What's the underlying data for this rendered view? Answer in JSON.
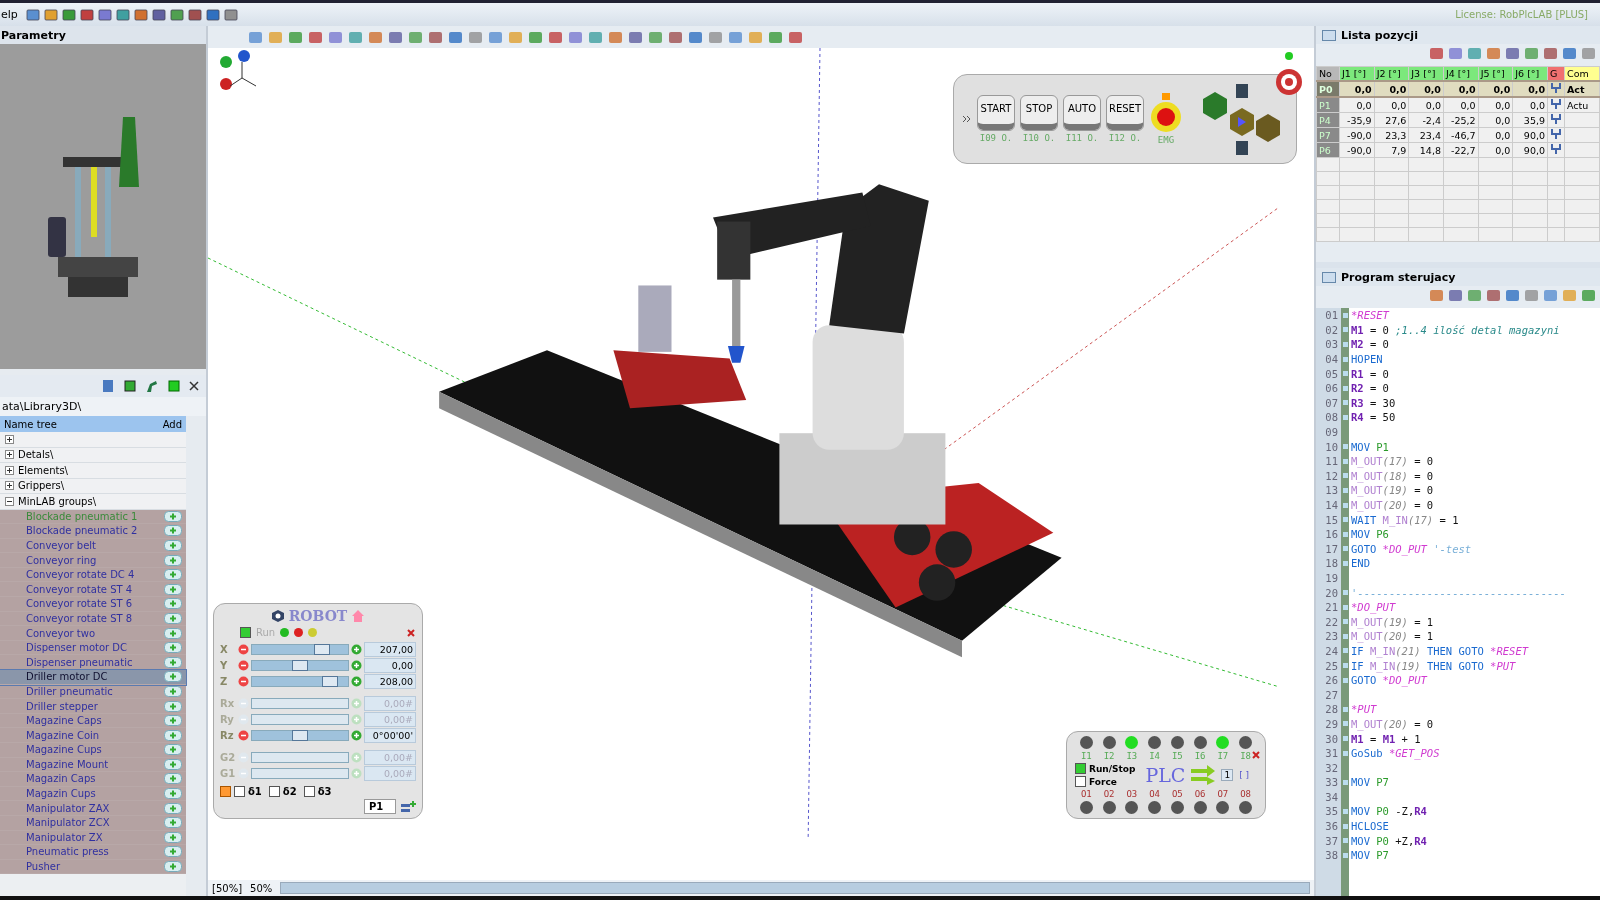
{
  "menu": {
    "label": "elp"
  },
  "license": "License: RobPlcLAB [PLUS]",
  "parameters_panel": {
    "title": "Parametry"
  },
  "library": {
    "path": "ata\\Library3D\\",
    "columns": [
      "Name tree",
      "Add"
    ],
    "tree": [
      {
        "expanded": false
      },
      {
        "label": "Detals\\",
        "expanded": false
      },
      {
        "label": "Elements\\",
        "expanded": false
      },
      {
        "label": "Grippers\\",
        "expanded": false
      },
      {
        "label": "MinLAB groups\\",
        "expanded": true,
        "children": [
          {
            "label": "Blockade pneumatic 1",
            "selected": false,
            "color": "#3a8a3a"
          },
          {
            "label": "Blockade pneumatic 2",
            "selected": false,
            "color": "#3030a0"
          },
          {
            "label": "Conveyor belt",
            "selected": false,
            "color": "#3030a0"
          },
          {
            "label": "Conveyor ring",
            "selected": false,
            "color": "#3030a0"
          },
          {
            "label": "Conveyor rotate DC 4",
            "selected": false,
            "color": "#3030a0"
          },
          {
            "label": "Conveyor rotate ST 4",
            "selected": false,
            "color": "#3030a0"
          },
          {
            "label": "Conveyor rotate ST 6",
            "selected": false,
            "color": "#3030a0"
          },
          {
            "label": "Conveyor rotate ST 8",
            "selected": false,
            "color": "#3030a0"
          },
          {
            "label": "Conveyor two",
            "selected": false,
            "color": "#3030a0"
          },
          {
            "label": "Dispenser motor DC",
            "selected": false,
            "color": "#3030a0"
          },
          {
            "label": "Dispenser pneumatic",
            "selected": false,
            "color": "#3030a0"
          },
          {
            "label": "Driller motor DC",
            "selected": true,
            "color": "#101030"
          },
          {
            "label": "Driller pneumatic",
            "selected": false,
            "color": "#3030a0"
          },
          {
            "label": "Driller stepper",
            "selected": false,
            "color": "#3030a0"
          },
          {
            "label": "Magazine Caps",
            "selected": false,
            "color": "#3030a0"
          },
          {
            "label": "Magazine Coin",
            "selected": false,
            "color": "#3030a0"
          },
          {
            "label": "Magazine Cups",
            "selected": false,
            "color": "#3030a0"
          },
          {
            "label": "Magazine Mount",
            "selected": false,
            "color": "#3030a0"
          },
          {
            "label": "Magazin Caps",
            "selected": false,
            "color": "#3030a0"
          },
          {
            "label": "Magazin Cups",
            "selected": false,
            "color": "#3030a0"
          },
          {
            "label": "Manipulator ZAX",
            "selected": false,
            "color": "#3030a0"
          },
          {
            "label": "Manipulator ZCX",
            "selected": false,
            "color": "#3030a0"
          },
          {
            "label": "Manipulator ZX",
            "selected": false,
            "color": "#3030a0"
          },
          {
            "label": "Pneumatic press",
            "selected": false,
            "color": "#3030a0"
          },
          {
            "label": "Pusher",
            "selected": false,
            "color": "#3030a0"
          }
        ]
      }
    ]
  },
  "control_panel": {
    "buttons": [
      "START",
      "STOP",
      "AUTO",
      "RESET"
    ],
    "signals": [
      "I09 O.",
      "I10 O.",
      "I11 O.",
      "I12 O."
    ],
    "emergency_label": "EMG"
  },
  "robot_panel": {
    "title": "ROBOT",
    "run_label": "Run",
    "run_checked": true,
    "axes": [
      {
        "label": "X",
        "disabled": false,
        "level": 0.78,
        "value": "207,00"
      },
      {
        "label": "Y",
        "disabled": false,
        "level": 0.5,
        "value": "0,00"
      },
      {
        "label": "Z",
        "disabled": false,
        "level": 0.87,
        "value": "208,00"
      },
      {
        "label": "Rx",
        "disabled": true,
        "value": "0,00#"
      },
      {
        "label": "Ry",
        "disabled": true,
        "value": "0,00#"
      },
      {
        "label": "Rz",
        "disabled": false,
        "level": 0.5,
        "value": "0°00'00'"
      },
      {
        "label": "G2",
        "disabled": true,
        "value": "0,00#"
      },
      {
        "label": "G1",
        "disabled": true,
        "value": "0,00#"
      }
    ],
    "options": [
      {
        "label": "δ1",
        "checked": false
      },
      {
        "label": "δ2",
        "checked": false
      },
      {
        "label": "δ3",
        "checked": false
      }
    ],
    "position": "P1"
  },
  "plc": {
    "title": "PLC",
    "inputs": [
      {
        "label": "I1",
        "on": false
      },
      {
        "label": "I2",
        "on": false
      },
      {
        "label": "I3",
        "on": true
      },
      {
        "label": "I4",
        "on": false
      },
      {
        "label": "I5",
        "on": false
      },
      {
        "label": "I6",
        "on": false
      },
      {
        "label": "I7",
        "on": true
      },
      {
        "label": "I8",
        "on": false
      }
    ],
    "outputs": [
      {
        "label": "O1",
        "on": false
      },
      {
        "label": "O2",
        "on": false
      },
      {
        "label": "O3",
        "on": false
      },
      {
        "label": "O4",
        "on": false
      },
      {
        "label": "O5",
        "on": false
      },
      {
        "label": "O6",
        "on": false
      },
      {
        "label": "O7",
        "on": false
      },
      {
        "label": "O8",
        "on": false
      }
    ],
    "options": [
      {
        "label": "Run/Stop",
        "checked": true
      },
      {
        "label": "Force",
        "checked": false
      }
    ],
    "cycle": "1",
    "brackets": "[ ]"
  },
  "status_bar": {
    "zoom_bracket": "[50%]",
    "zoom": "50%"
  },
  "position_list": {
    "title": "Lista pozycji",
    "columns": [
      "No",
      "J1 [°]",
      "J2 [°]",
      "J3 [°]",
      "J4 [°]",
      "J5 [°]",
      "J6 [°]",
      "G",
      "Com"
    ],
    "rows": [
      {
        "name": "P0",
        "values": [
          "0,0",
          "0,0",
          "0,0",
          "0,0",
          "0,0",
          "0,0"
        ],
        "comment": "Act",
        "selected": true
      },
      {
        "name": "P1",
        "values": [
          "0,0",
          "0,0",
          "0,0",
          "0,0",
          "0,0",
          "0,0"
        ],
        "comment": "Actu",
        "selected": false
      },
      {
        "name": "P4",
        "values": [
          "-35,9",
          "27,6",
          "-2,4",
          "-25,2",
          "0,0",
          "35,9"
        ],
        "selected": false
      },
      {
        "name": "P7",
        "values": [
          "-90,0",
          "23,3",
          "23,4",
          "-46,7",
          "0,0",
          "90,0"
        ],
        "selected": false
      },
      {
        "name": "P6",
        "values": [
          "-90,0",
          "7,9",
          "14,8",
          "-22,7",
          "0,0",
          "90,0"
        ],
        "selected": false
      }
    ]
  },
  "program": {
    "title": "Program sterujacy",
    "lines": [
      {
        "no": "01",
        "parts": [
          {
            "t": "*RESET",
            "kind": "label"
          }
        ]
      },
      {
        "no": "02",
        "parts": [
          {
            "t": "M1",
            "kind": "var"
          },
          {
            "t": " = 0  ",
            "kind": "op"
          },
          {
            "t": ";1..4 ilość detal magazyni",
            "kind": "comment"
          }
        ]
      },
      {
        "no": "03",
        "parts": [
          {
            "t": "M2",
            "kind": "var"
          },
          {
            "t": " = 0",
            "kind": "op"
          }
        ]
      },
      {
        "no": "04",
        "parts": [
          {
            "t": "HOPEN",
            "kind": "kw"
          }
        ]
      },
      {
        "no": "05",
        "parts": [
          {
            "t": "R1",
            "kind": "var"
          },
          {
            "t": " = 0",
            "kind": "op"
          }
        ]
      },
      {
        "no": "06",
        "parts": [
          {
            "t": "R2",
            "kind": "var"
          },
          {
            "t": " = 0",
            "kind": "op"
          }
        ]
      },
      {
        "no": "07",
        "parts": [
          {
            "t": "R3",
            "kind": "var"
          },
          {
            "t": " = 30",
            "kind": "op"
          }
        ]
      },
      {
        "no": "08",
        "parts": [
          {
            "t": "R4",
            "kind": "var"
          },
          {
            "t": " = 50",
            "kind": "op"
          }
        ]
      },
      {
        "no": "09"
      },
      {
        "no": "10",
        "parts": [
          {
            "t": "MOV ",
            "kind": "kw"
          },
          {
            "t": "P1",
            "kind": "point"
          }
        ]
      },
      {
        "no": "11",
        "parts": [
          {
            "t": "M_OUT",
            "kind": "io"
          },
          {
            "t": "(17)",
            "kind": "arg"
          },
          {
            "t": " = 0",
            "kind": "op"
          }
        ]
      },
      {
        "no": "12",
        "parts": [
          {
            "t": "M_OUT",
            "kind": "io"
          },
          {
            "t": "(18)",
            "kind": "arg"
          },
          {
            "t": " = 0",
            "kind": "op"
          }
        ]
      },
      {
        "no": "13",
        "parts": [
          {
            "t": "M_OUT",
            "kind": "io"
          },
          {
            "t": "(19)",
            "kind": "arg"
          },
          {
            "t": " = 0",
            "kind": "op"
          }
        ]
      },
      {
        "no": "14",
        "parts": [
          {
            "t": "M_OUT",
            "kind": "io"
          },
          {
            "t": "(20)",
            "kind": "arg"
          },
          {
            "t": " = 0",
            "kind": "op"
          }
        ]
      },
      {
        "no": "15",
        "parts": [
          {
            "t": "WAIT ",
            "kind": "kw"
          },
          {
            "t": "M_IN",
            "kind": "io"
          },
          {
            "t": "(17)",
            "kind": "arg"
          },
          {
            "t": " = 1",
            "kind": "op"
          }
        ]
      },
      {
        "no": "16",
        "parts": [
          {
            "t": "MOV ",
            "kind": "kw"
          },
          {
            "t": "P6",
            "kind": "point"
          }
        ]
      },
      {
        "no": "17",
        "parts": [
          {
            "t": "GOTO ",
            "kind": "kw"
          },
          {
            "t": "*DO_PUT ",
            "kind": "label"
          },
          {
            "t": "'-test",
            "kind": "note"
          }
        ]
      },
      {
        "no": "18",
        "parts": [
          {
            "t": "END",
            "kind": "kw"
          }
        ]
      },
      {
        "no": "19"
      },
      {
        "no": "20",
        "parts": [
          {
            "t": "'---------------------------------",
            "kind": "note"
          }
        ]
      },
      {
        "no": "21",
        "parts": [
          {
            "t": "*DO_PUT",
            "kind": "label"
          }
        ]
      },
      {
        "no": "22",
        "parts": [
          {
            "t": "M_OUT",
            "kind": "io"
          },
          {
            "t": "(19)",
            "kind": "arg"
          },
          {
            "t": " = 1",
            "kind": "op"
          }
        ]
      },
      {
        "no": "23",
        "parts": [
          {
            "t": "M_OUT",
            "kind": "io"
          },
          {
            "t": "(20)",
            "kind": "arg"
          },
          {
            "t": " = 1",
            "kind": "op"
          }
        ]
      },
      {
        "no": "24",
        "parts": [
          {
            "t": "IF ",
            "kind": "kw"
          },
          {
            "t": "M_IN",
            "kind": "io"
          },
          {
            "t": "(21)",
            "kind": "arg"
          },
          {
            "t": " THEN GOTO ",
            "kind": "kw"
          },
          {
            "t": "*RESET",
            "kind": "label"
          }
        ]
      },
      {
        "no": "25",
        "parts": [
          {
            "t": "IF ",
            "kind": "kw"
          },
          {
            "t": "M_IN",
            "kind": "io"
          },
          {
            "t": "(19)",
            "kind": "arg"
          },
          {
            "t": " THEN GOTO ",
            "kind": "kw"
          },
          {
            "t": "*PUT",
            "kind": "label"
          }
        ]
      },
      {
        "no": "26",
        "parts": [
          {
            "t": "GOTO ",
            "kind": "kw"
          },
          {
            "t": "*DO_PUT",
            "kind": "label"
          }
        ]
      },
      {
        "no": "27"
      },
      {
        "no": "28",
        "parts": [
          {
            "t": "*PUT",
            "kind": "label"
          }
        ]
      },
      {
        "no": "29",
        "parts": [
          {
            "t": "M_OUT",
            "kind": "io"
          },
          {
            "t": "(20)",
            "kind": "arg"
          },
          {
            "t": " = 0",
            "kind": "op"
          }
        ]
      },
      {
        "no": "30",
        "parts": [
          {
            "t": "M1",
            "kind": "var"
          },
          {
            "t": " = ",
            "kind": "op"
          },
          {
            "t": "M1",
            "kind": "var"
          },
          {
            "t": " + 1",
            "kind": "op"
          }
        ]
      },
      {
        "no": "31",
        "parts": [
          {
            "t": "GoSub ",
            "kind": "kw"
          },
          {
            "t": "*GET_POS",
            "kind": "label"
          }
        ]
      },
      {
        "no": "32"
      },
      {
        "no": "33",
        "parts": [
          {
            "t": "MOV ",
            "kind": "kw"
          },
          {
            "t": "P7",
            "kind": "point"
          }
        ]
      },
      {
        "no": "34"
      },
      {
        "no": "35",
        "parts": [
          {
            "t": "MOV ",
            "kind": "kw"
          },
          {
            "t": "P0 ",
            "kind": "point"
          },
          {
            "t": "-Z,",
            "kind": "op"
          },
          {
            "t": "R4",
            "kind": "var"
          }
        ]
      },
      {
        "no": "36",
        "parts": [
          {
            "t": "HCLOSE",
            "kind": "kw"
          }
        ]
      },
      {
        "no": "37",
        "parts": [
          {
            "t": "MOV ",
            "kind": "kw"
          },
          {
            "t": "P0 ",
            "kind": "point"
          },
          {
            "t": "+Z,",
            "kind": "op"
          },
          {
            "t": "R4",
            "kind": "var"
          }
        ]
      },
      {
        "no": "38",
        "parts": [
          {
            "t": "MOV ",
            "kind": "kw"
          },
          {
            "t": "P7",
            "kind": "point"
          }
        ]
      }
    ]
  }
}
